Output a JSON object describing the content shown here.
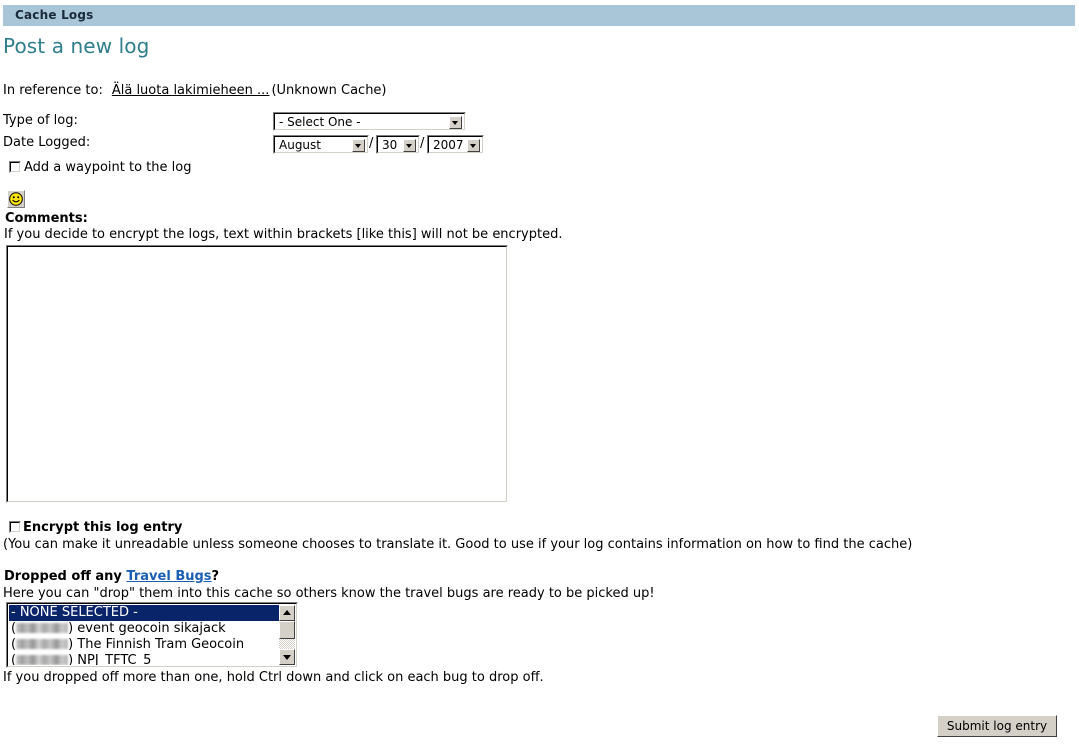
{
  "titlebar": {
    "title": "Cache Logs",
    "bg_color": "#a9c6d8"
  },
  "heading": {
    "text": "Post a new log",
    "color": "#2f7e8c"
  },
  "reference": {
    "label": "In reference to:",
    "cache_name": "Älä luota lakimieheen ...",
    "cache_type": "(Unknown Cache)"
  },
  "form": {
    "type_label": "Type of log:",
    "type_value": "- Select One -",
    "date_label": "Date Logged:",
    "month_value": "August",
    "day_value": "30",
    "year_value": "2007",
    "separator": "/",
    "waypoint_label": "Add a waypoint to the log"
  },
  "comments": {
    "smiley_icon": "smiley-face-icon",
    "label": "Comments:",
    "encrypt_note": "If you decide to encrypt the logs, text within brackets [like this] will not be encrypted.",
    "textarea_value": "",
    "textarea_placeholder": ""
  },
  "encrypt": {
    "label": "Encrypt this log entry",
    "description": "(You can make it unreadable unless someone chooses to translate it. Good to use if your log contains information on how to find the cache)"
  },
  "travel_bugs": {
    "heading_prefix": "Dropped off any ",
    "link_text": "Travel Bugs",
    "heading_suffix": "?",
    "link_color": "#1a5fb4",
    "description": "Here you can \"drop\" them into this cache so others know the travel bugs are ready to be picked up!",
    "selection_color": "#0a246a",
    "items": [
      {
        "code": "",
        "redacted": false,
        "label": "- NONE SELECTED -",
        "selected": true
      },
      {
        "code": "",
        "redacted": true,
        "label": ") event geocoin sikajack",
        "selected": false
      },
      {
        "code": "",
        "redacted": true,
        "label": ") The Finnish Tram Geocoin",
        "selected": false
      },
      {
        "code": "",
        "redacted": true,
        "label": ") NPJ_TFTC_5",
        "selected": false
      }
    ],
    "hint": "If you dropped off more than one, hold Ctrl down and click on each bug to drop off."
  },
  "submit": {
    "label": "Submit log entry"
  }
}
